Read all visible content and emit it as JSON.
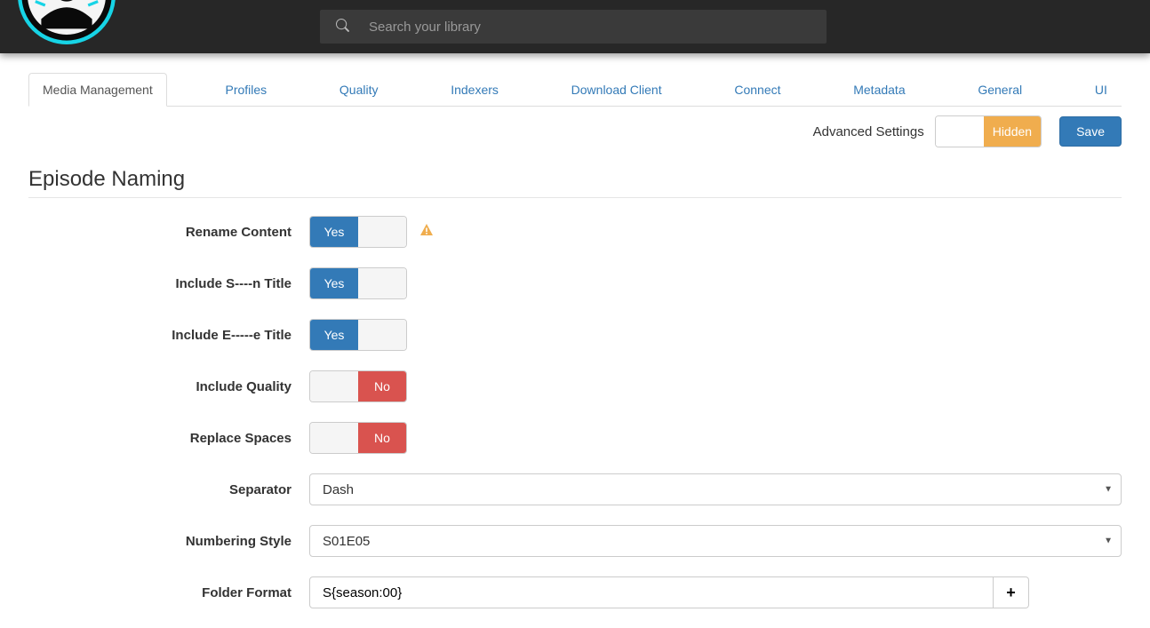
{
  "search": {
    "placeholder": "Search your library"
  },
  "tabs": [
    "Media Management",
    "Profiles",
    "Quality",
    "Indexers",
    "Download Client",
    "Connect",
    "Metadata",
    "General",
    "UI"
  ],
  "toolbar": {
    "advanced_label": "Advanced Settings",
    "advanced_value": "Hidden",
    "save_label": "Save"
  },
  "section": {
    "title": "Episode Naming"
  },
  "fields": {
    "rename_content": {
      "label": "Rename Content",
      "value": "Yes",
      "warn": true
    },
    "include_season_title": {
      "label": "Include S----n Title",
      "value": "Yes"
    },
    "include_episode_title": {
      "label": "Include E-----e Title",
      "value": "Yes"
    },
    "include_quality": {
      "label": "Include Quality",
      "value": "No"
    },
    "replace_spaces": {
      "label": "Replace Spaces",
      "value": "No"
    },
    "separator": {
      "label": "Separator",
      "value": "Dash"
    },
    "numbering_style": {
      "label": "Numbering Style",
      "value": "S01E05"
    },
    "folder_format": {
      "label": "Folder Format",
      "value": "S{season:00}"
    }
  },
  "labels": {
    "yes": "Yes",
    "no": "No",
    "plus": "+"
  }
}
